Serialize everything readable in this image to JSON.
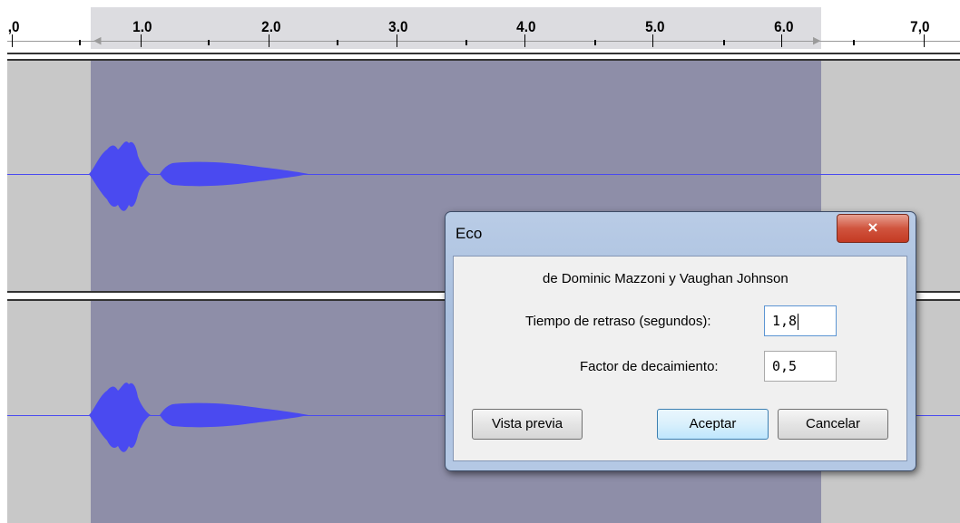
{
  "ruler": {
    "labels": [
      ",0",
      "1.0",
      "2.0",
      "3.0",
      "4.0",
      "5.0",
      "6.0",
      "7,0"
    ]
  },
  "tracks": {
    "waveform_color": "#4a4af0",
    "selection_color": "#8e8ea8",
    "background_color": "#c8c8c8"
  },
  "dialog": {
    "title": "Eco",
    "close_icon": "×",
    "credit": "de Dominic Mazzoni y Vaughan Johnson",
    "delay_label": "Tiempo de retraso (segundos):",
    "delay_value": "1,8",
    "decay_label": "Factor de decaimiento:",
    "decay_value": "0,5",
    "preview_button": "Vista previa",
    "ok_button": "Aceptar",
    "cancel_button": "Cancelar"
  }
}
